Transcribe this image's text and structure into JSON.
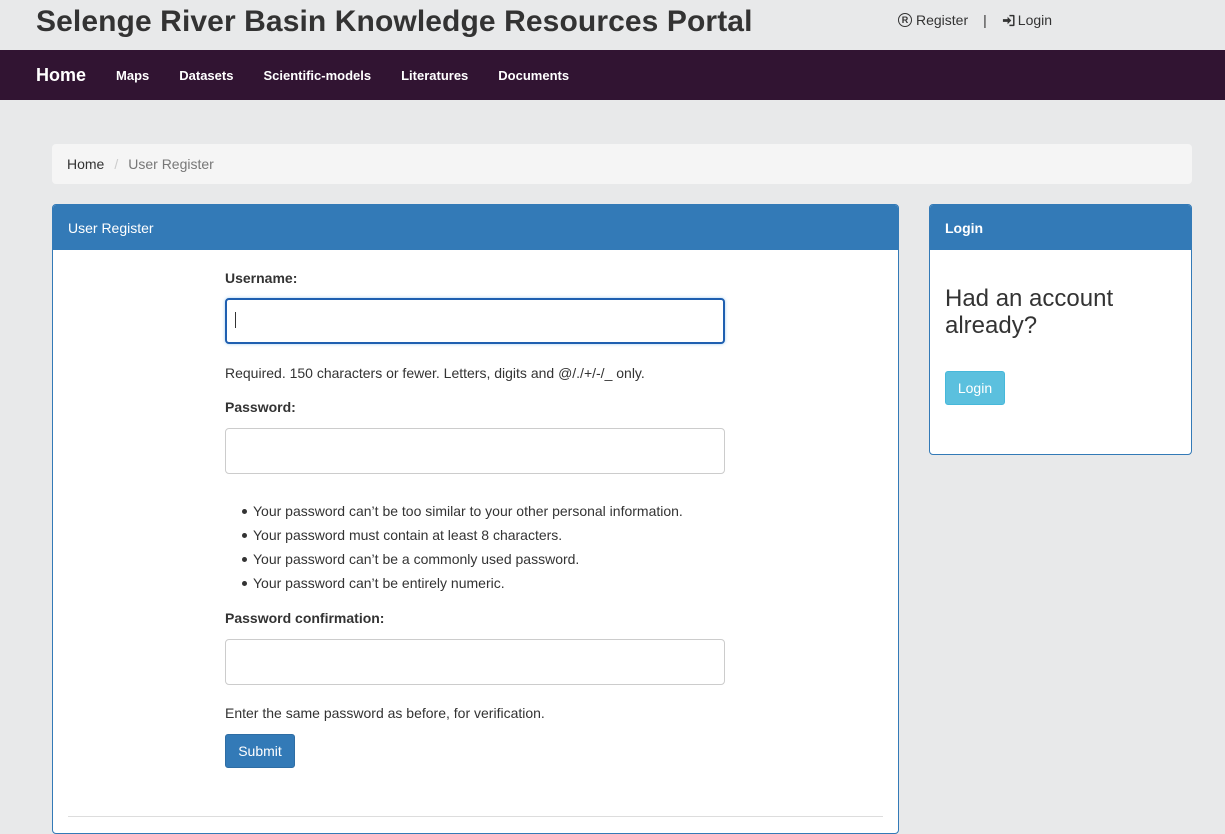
{
  "header": {
    "title": "Selenge River Basin Knowledge Resources Portal",
    "register_label": "Register",
    "separator": "|",
    "login_label": "Login"
  },
  "nav": {
    "home": "Home",
    "items": [
      "Maps",
      "Datasets",
      "Scientific-models",
      "Literatures",
      "Documents"
    ]
  },
  "breadcrumb": {
    "home": "Home",
    "separator": "/",
    "current": "User Register"
  },
  "register_panel": {
    "title": "User Register",
    "username_label": "Username:",
    "username_value": "",
    "username_help": "Required. 150 characters or fewer. Letters, digits and @/./+/-/_ only.",
    "password_label": "Password:",
    "password_value": "",
    "password_rules": [
      "Your password can’t be too similar to your other personal information.",
      "Your password must contain at least 8 characters.",
      "Your password can’t be a commonly used password.",
      "Your password can’t be entirely numeric."
    ],
    "confirm_label": "Password confirmation:",
    "confirm_value": "",
    "confirm_help": "Enter the same password as before, for verification.",
    "submit_label": "Submit"
  },
  "login_panel": {
    "title": "Login",
    "question": "Had an account already?",
    "button_label": "Login"
  },
  "colors": {
    "navbar_bg": "#311432",
    "panel_primary": "#337ab7",
    "login_button": "#5bc0de",
    "page_bg": "#e8e9ea"
  },
  "icons": {
    "register": "registered-icon",
    "login": "sign-in-icon"
  }
}
